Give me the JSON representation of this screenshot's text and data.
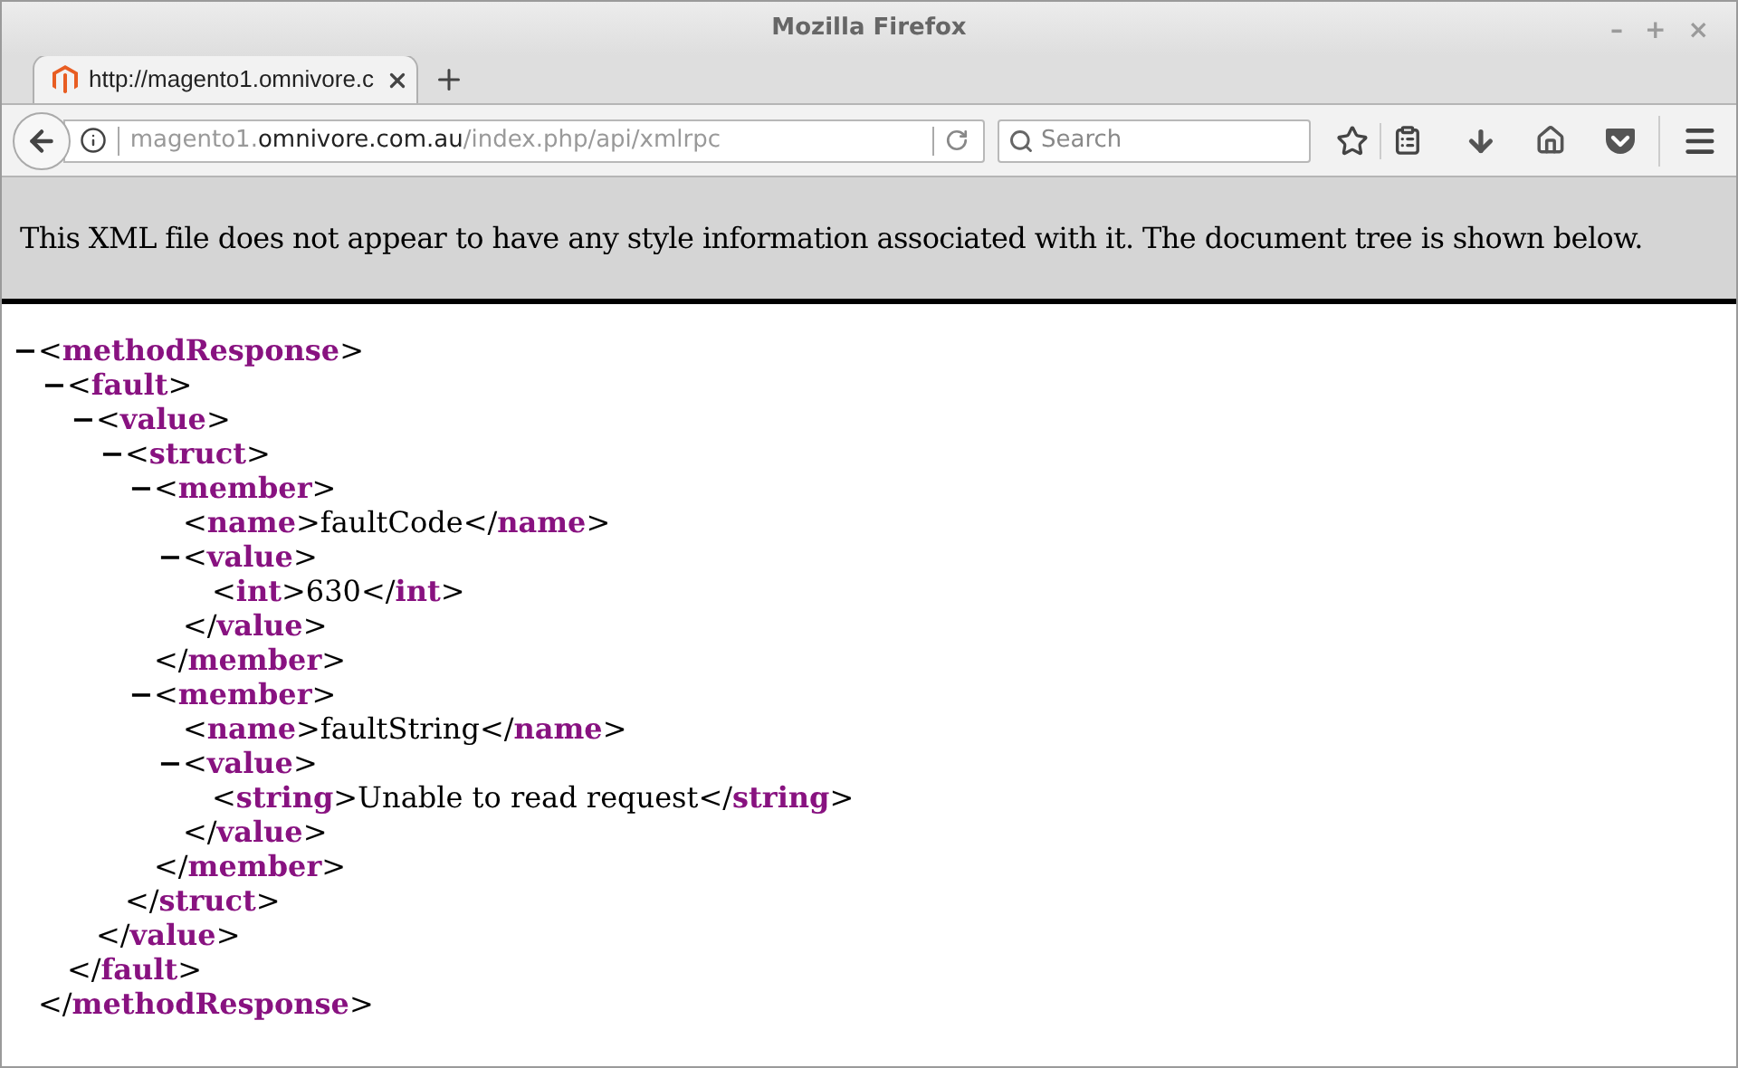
{
  "window": {
    "title": "Mozilla Firefox",
    "controls": [
      "–",
      "+",
      "×"
    ]
  },
  "tabs": [
    {
      "label": "http://magento1.omnivore.c",
      "selected": true
    }
  ],
  "address_bar": {
    "host_prefix": "magento1.",
    "domain": "omnivore.com.au",
    "path": "/index.php/api/xmlrpc"
  },
  "search": {
    "placeholder": "Search"
  },
  "info_bar": {
    "text": "This XML file does not appear to have any style information associated with it. The document tree is shown below."
  },
  "xml_tree": [
    {
      "toggle": "−",
      "markup": "<**methodResponse**>",
      "close": "</**methodResponse**>",
      "children": [
        {
          "toggle": "−",
          "markup": "<**fault**>",
          "close": "</**fault**>",
          "children": [
            {
              "toggle": "−",
              "markup": "<**value**>",
              "close": "</**value**>",
              "children": [
                {
                  "toggle": "−",
                  "markup": "<**struct**>",
                  "close": "</**struct**>",
                  "children": [
                    {
                      "toggle": "−",
                      "markup": "<**member**>",
                      "close": "</**member**>",
                      "children": [
                        {
                          "markup": "<**name**>faultCode</**name**>"
                        },
                        {
                          "toggle": "−",
                          "markup": "<**value**>",
                          "close": "</**value**>",
                          "children": [
                            {
                              "markup": "<**int**>630</**int**>"
                            }
                          ]
                        }
                      ]
                    },
                    {
                      "toggle": "−",
                      "markup": "<**member**>",
                      "close": "</**member**>",
                      "children": [
                        {
                          "markup": "<**name**>faultString</**name**>"
                        },
                        {
                          "toggle": "−",
                          "markup": "<**value**>",
                          "close": "</**value**>",
                          "children": [
                            {
                              "markup": "<**string**>Unable to read request</**string**>"
                            }
                          ]
                        }
                      ]
                    }
                  ]
                }
              ]
            }
          ]
        }
      ]
    }
  ]
}
